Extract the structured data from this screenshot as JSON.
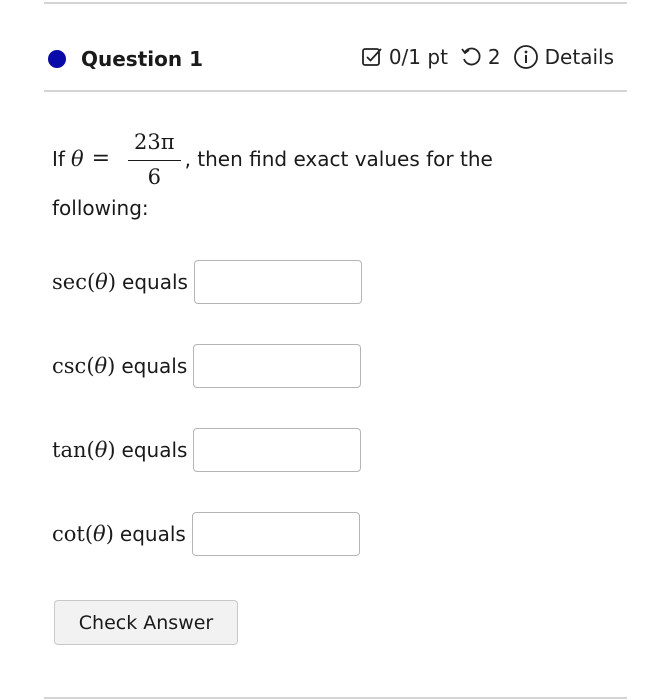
{
  "question": {
    "title": "Question 1",
    "points": "0/1 pt",
    "attempts": "2",
    "details_label": "Details",
    "status_color": "#0a0aa8",
    "icons": {
      "points": "checkbox-edit-icon",
      "attempts": "retry-icon",
      "details": "info-icon"
    }
  },
  "problem": {
    "prefix": "If",
    "variable": "θ",
    "equals": "=",
    "numerator": "23π",
    "denominator": "6",
    "suffix": ", then find exact values for the",
    "line2": "following:"
  },
  "rows": [
    {
      "fn": "sec",
      "arg": "θ",
      "text": "equals",
      "value": ""
    },
    {
      "fn": "csc",
      "arg": "θ",
      "text": "equals",
      "value": ""
    },
    {
      "fn": "tan",
      "arg": "θ",
      "text": "equals",
      "value": ""
    },
    {
      "fn": "cot",
      "arg": "θ",
      "text": "equals",
      "value": ""
    }
  ],
  "check_button": "Check Answer"
}
